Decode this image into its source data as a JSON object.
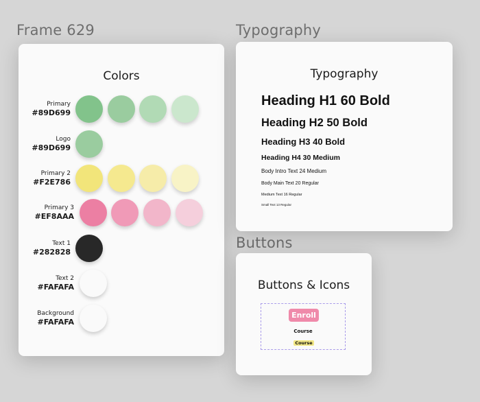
{
  "canvas": {
    "frames": [
      {
        "label": "Frame 629"
      },
      {
        "label": "Typography"
      },
      {
        "label": "Buttons"
      }
    ]
  },
  "colors": {
    "title": "Colors",
    "rows": [
      {
        "name": "Primary",
        "hex": "#89D699",
        "swatches": [
          "#82c38b",
          "#9acc9f",
          "#b1dab5",
          "#cbe7cd"
        ]
      },
      {
        "name": "Logo",
        "hex": "#89D699",
        "swatches": [
          "#9acc9f"
        ]
      },
      {
        "name": "Primary 2",
        "hex": "#F2E786",
        "swatches": [
          "#f2e57a",
          "#f5e98f",
          "#f6eca9",
          "#f8f3c6"
        ]
      },
      {
        "name": "Primary 3",
        "hex": "#EF8AAA",
        "swatches": [
          "#ec7fa3",
          "#f09ab7",
          "#f2b6ca",
          "#f5cfdc"
        ]
      },
      {
        "name": "Text 1",
        "hex": "#282828",
        "swatches": [
          "#282828"
        ]
      },
      {
        "name": "Text 2",
        "hex": "#FAFAFA",
        "swatches": [
          "#fafafa"
        ]
      },
      {
        "name": "Background",
        "hex": "#FAFAFA",
        "swatches": [
          "#fafafa"
        ]
      }
    ]
  },
  "typography": {
    "title": "Typography",
    "lines": [
      "Heading H1 60 Bold",
      "Heading H2 50 Bold",
      "Heading H3 40 Bold",
      "Heading H4  30 Medium",
      "Body Intro Text 24 Medium",
      "Body Main Text 20 Regular",
      "Medium Text 16 Regular",
      "Small Text 13 Regular"
    ]
  },
  "buttons": {
    "title": "Buttons & Icons",
    "enroll_label": "Enroll",
    "course_text": "Course",
    "course_tag": "Course"
  }
}
